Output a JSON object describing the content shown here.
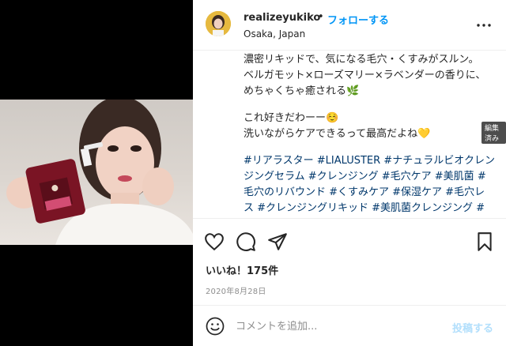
{
  "header": {
    "username": "realizeyukiko",
    "separator": "•",
    "follow_label": "フォローする",
    "location": "Osaka, Japan"
  },
  "caption": {
    "line1": "濃密リキッドで、気になる毛穴・くすみがスルン。",
    "line2": "ベルガモット×ローズマリー×ラベンダーの香りに、めちゃくちゃ癒される🌿",
    "line3": "これ好きだわーー☺️",
    "line4": "洗いながらケアできるって最高だよね💛",
    "hashtags": "#リアラスター #LIALUSTER #ナチュラルビオクレンジングセラム #クレンジング #毛穴ケア #美肌菌 #毛穴のリバウンド #くすみケア #保湿ケア #毛穴レス #クレンジングリキッド #美肌菌クレンジング #菌活クレンジング #肌フローラ #バイオスキンケア #PR",
    "edited_tooltip": "編集済み"
  },
  "engagement": {
    "likes_text": "いいね！175件",
    "date": "2020年8月28日"
  },
  "comment": {
    "placeholder": "コメントを追加...",
    "post_label": "投稿する"
  },
  "icons": {
    "like": "heart-icon",
    "comment": "comment-icon",
    "share": "paper-plane-icon",
    "save": "bookmark-icon",
    "more": "ellipsis-icon",
    "emoji": "smiley-icon",
    "next": "chevron-right-icon",
    "tag": "user-tag-icon"
  },
  "colors": {
    "link_blue": "#0095f6",
    "hashtag_blue": "#00376b",
    "post_disabled": "#b2dffc"
  }
}
